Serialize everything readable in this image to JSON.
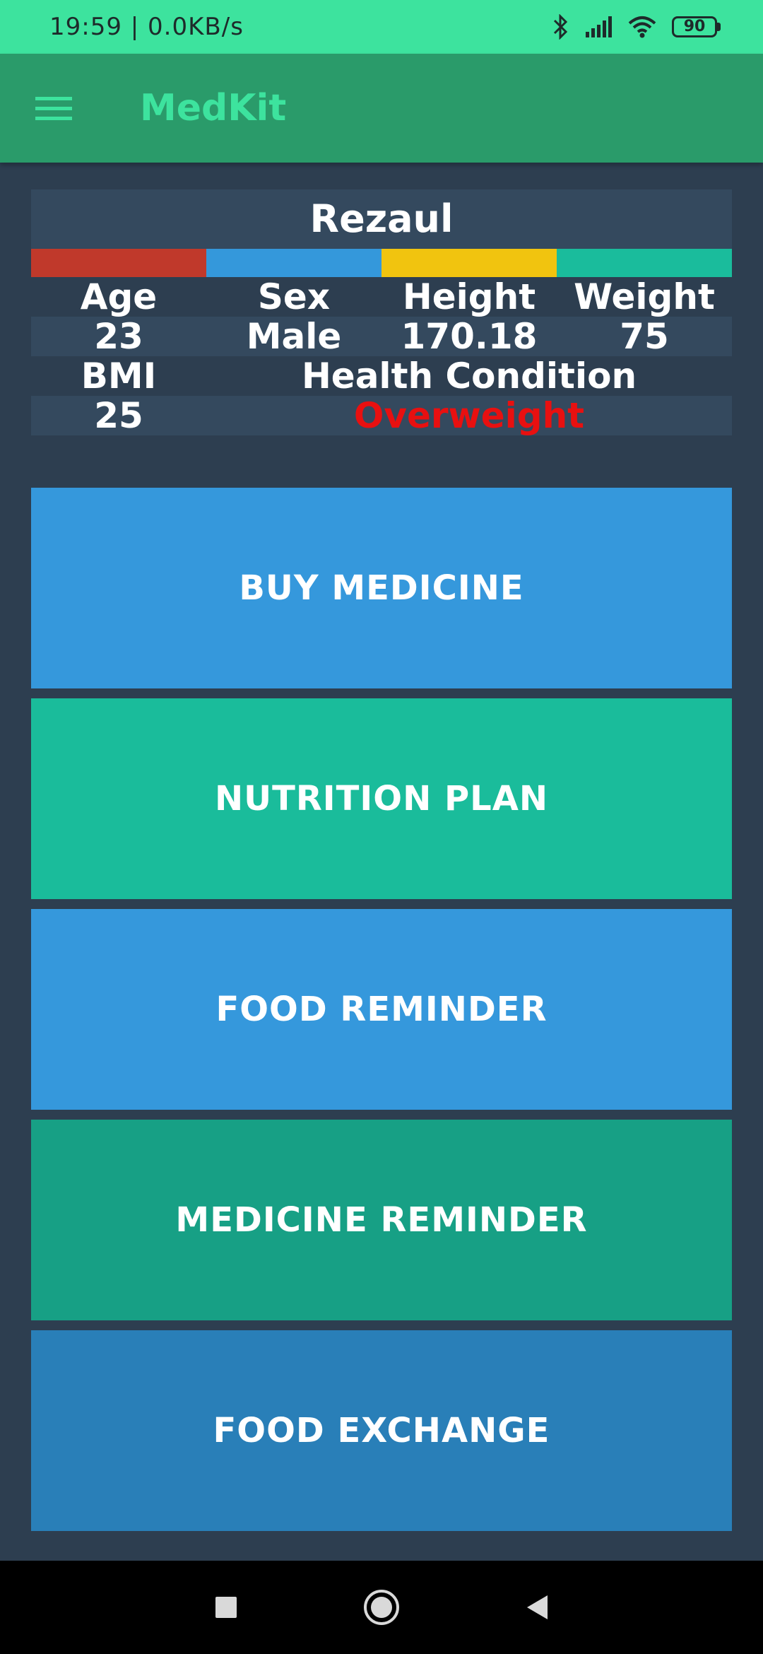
{
  "status_bar": {
    "time_speed": "19:59 | 0.0KB/s",
    "battery": "90"
  },
  "app_bar": {
    "title": "MedKit",
    "menu_icon": "hamburger-menu-icon"
  },
  "profile": {
    "name": "Rezaul",
    "strip_colors": [
      "#c0392b",
      "#3498db",
      "#f1c40f",
      "#1abc9c"
    ],
    "headers": [
      "Age",
      "Sex",
      "Height",
      "Weight"
    ],
    "values": [
      "23",
      "Male",
      "170.18",
      "75"
    ],
    "bmi_label": "BMI",
    "condition_label": "Health Condition",
    "bmi_value": "25",
    "condition_value": "Overweight"
  },
  "buttons": [
    {
      "label": "BUY MEDICINE",
      "color": "#3598dc"
    },
    {
      "label": "NUTRITION PLAN",
      "color": "#1abc9b"
    },
    {
      "label": "FOOD REMINDER",
      "color": "#3598dc"
    },
    {
      "label": "MEDICINE REMINDER",
      "color": "#17a085"
    },
    {
      "label": "FOOD EXCHANGE",
      "color": "#297fb8"
    }
  ],
  "nav_bar": {
    "icons": [
      "recents-square-icon",
      "home-circle-icon",
      "back-triangle-icon"
    ]
  }
}
